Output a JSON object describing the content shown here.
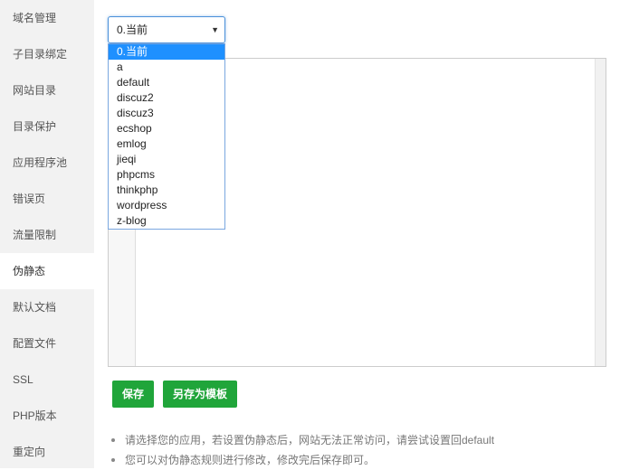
{
  "sidebar": {
    "items": [
      {
        "label": "域名管理"
      },
      {
        "label": "子目录绑定"
      },
      {
        "label": "网站目录"
      },
      {
        "label": "目录保护"
      },
      {
        "label": "应用程序池"
      },
      {
        "label": "错误页"
      },
      {
        "label": "流量限制"
      },
      {
        "label": "伪静态",
        "active": true
      },
      {
        "label": "默认文档"
      },
      {
        "label": "配置文件"
      },
      {
        "label": "SSL"
      },
      {
        "label": "PHP版本"
      },
      {
        "label": "重定向"
      }
    ]
  },
  "rewrite_select": {
    "value": "0.当前",
    "arrow_icon": "triangle-down-icon",
    "options": [
      "0.当前",
      "a",
      "default",
      "discuz2",
      "discuz3",
      "ecshop",
      "emlog",
      "jieqi",
      "phpcms",
      "thinkphp",
      "wordpress",
      "z-blog"
    ],
    "selected_index": 0
  },
  "buttons": {
    "save_label": "保存",
    "save_as_template_label": "另存为模板"
  },
  "tips": [
    "请选择您的应用，若设置伪静态后，网站无法正常访问，请尝试设置回default",
    "您可以对伪静态规则进行修改，修改完后保存即可。"
  ],
  "colors": {
    "primary_button": "#20a53a",
    "selected_option": "#1e90ff",
    "select_border": "#4a90d9"
  }
}
